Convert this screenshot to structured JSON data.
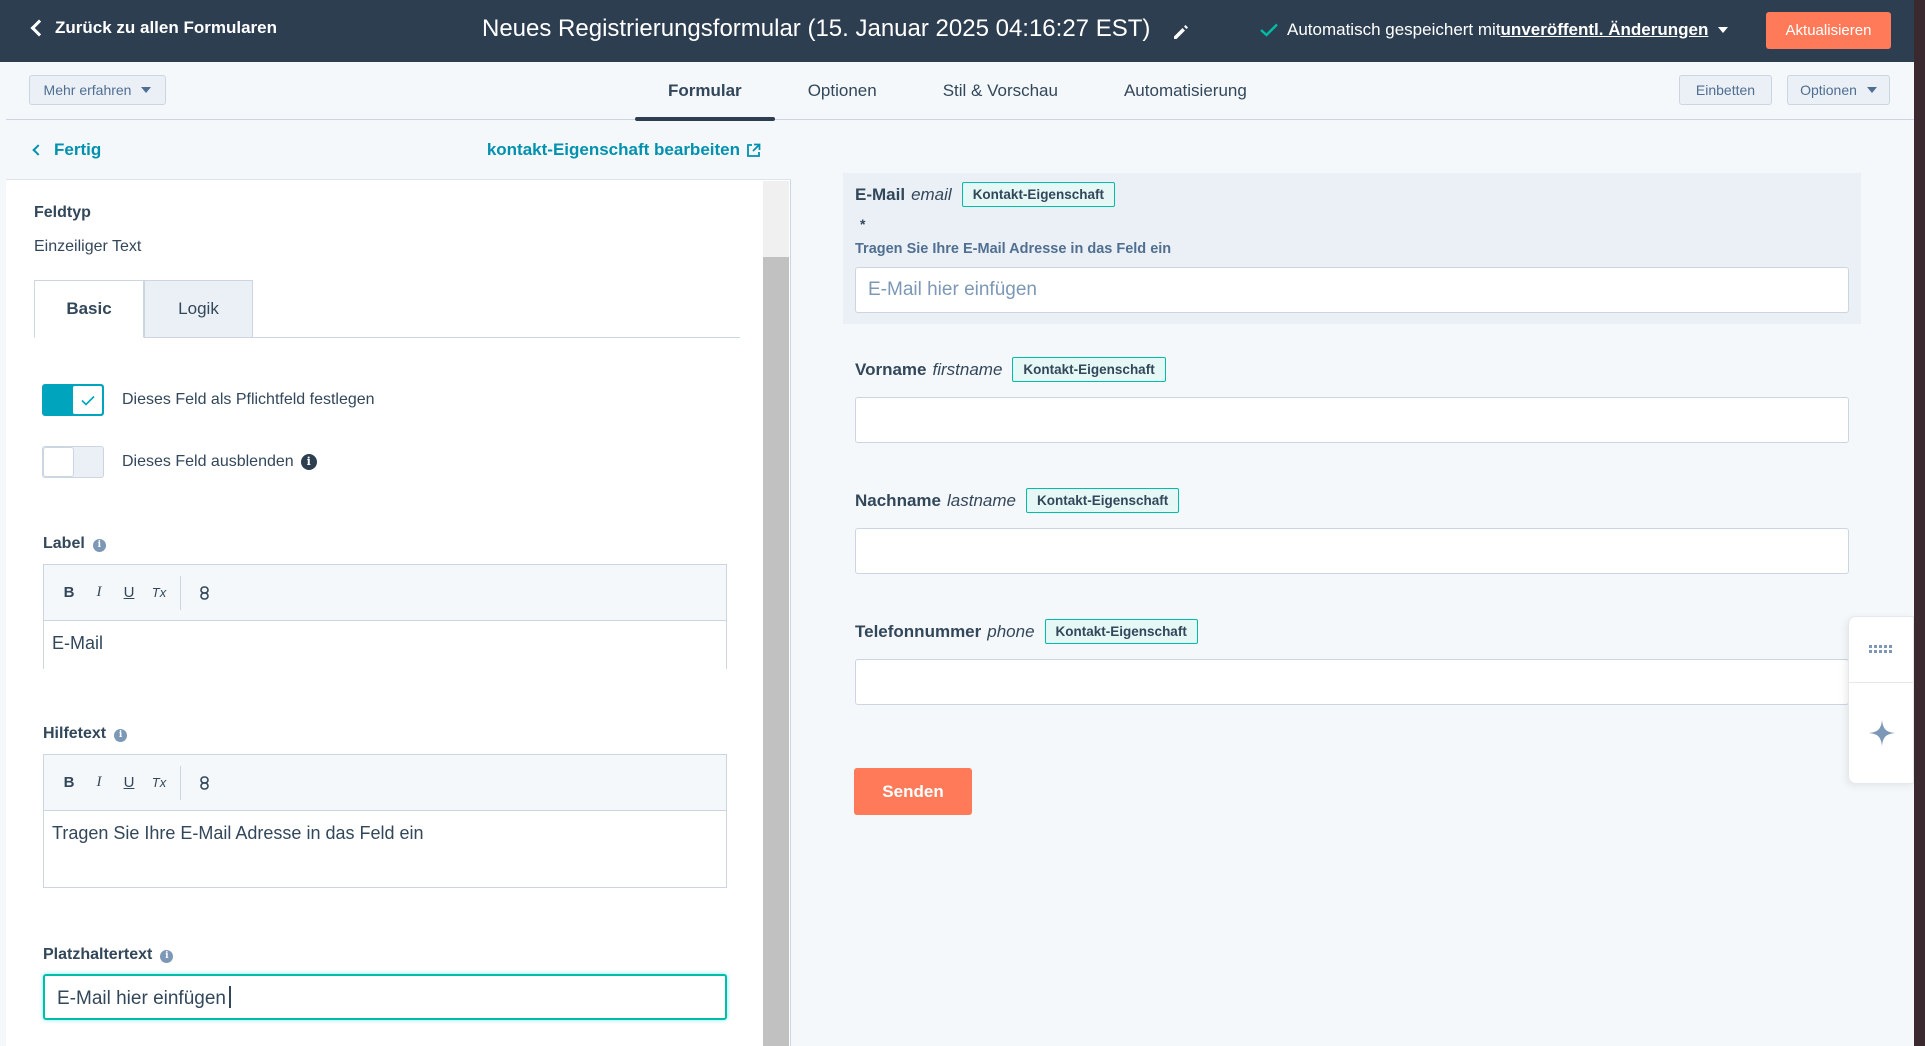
{
  "topbar": {
    "back_label": "Zurück zu allen Formularen",
    "title": "Neues Registrierungsformular (15. Januar 2025 04:16:27 EST)",
    "save_status_prefix": "Automatisch gespeichert mit ",
    "save_status_link": "unveröffentl. Änderungen",
    "update_label": "Aktualisieren"
  },
  "subbar": {
    "learn_more_label": "Mehr erfahren",
    "tabs": [
      {
        "label": "Formular"
      },
      {
        "label": "Optionen"
      },
      {
        "label": "Stil & Vorschau"
      },
      {
        "label": "Automatisierung"
      }
    ],
    "embed_label": "Einbetten",
    "options_label": "Optionen"
  },
  "left_panel": {
    "done_label": "Fertig",
    "edit_property_label": "kontakt-Eigenschaft bearbeiten",
    "field_type_heading": "Feldtyp",
    "field_type_value": "Einzeiliger Text",
    "inner_tabs": [
      {
        "label": "Basic"
      },
      {
        "label": "Logik"
      }
    ],
    "toggle_required": {
      "label": "Dieses Feld als Pflichtfeld festlegen",
      "on": true
    },
    "toggle_hidden": {
      "label": "Dieses Feld ausblenden",
      "on": false
    },
    "label_heading": "Label",
    "label_value": "E-Mail",
    "help_heading": "Hilfetext",
    "help_value": "Tragen Sie Ihre E-Mail Adresse in das Feld ein",
    "placeholder_heading": "Platzhaltertext",
    "placeholder_value": "E-Mail hier einfügen",
    "toolbar": {
      "bold": "B",
      "italic": "I",
      "underline": "U",
      "clear": "Tx"
    }
  },
  "preview": {
    "fields": [
      {
        "label": "E-Mail",
        "property": "email",
        "badge": "Kontakt-Eigenschaft",
        "required": "*",
        "help": "Tragen Sie Ihre E-Mail Adresse in das Feld ein",
        "placeholder": "E-Mail hier einfügen"
      },
      {
        "label": "Vorname",
        "property": "firstname",
        "badge": "Kontakt-Eigenschaft",
        "placeholder": ""
      },
      {
        "label": "Nachname",
        "property": "lastname",
        "badge": "Kontakt-Eigenschaft",
        "placeholder": ""
      },
      {
        "label": "Telefonnummer",
        "property": "phone",
        "badge": "Kontakt-Eigenschaft",
        "placeholder": ""
      }
    ],
    "submit_label": "Senden"
  },
  "colors": {
    "topbar_bg": "#2d3e50",
    "accent_orange": "#ff7a59",
    "teal": "#00a4bd",
    "link": "#0091ae"
  },
  "icons": [
    "chevron-left-icon",
    "pencil-icon",
    "check-icon",
    "caret-down-icon",
    "external-link-icon",
    "info-icon",
    "grid-icon",
    "sparkle-icon"
  ]
}
